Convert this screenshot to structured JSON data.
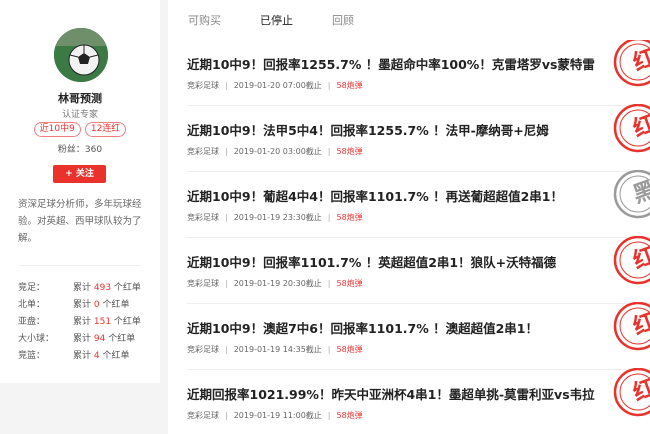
{
  "profile": {
    "name": "林哥预测",
    "cert": "认证专家",
    "badges": [
      "近10中9",
      "12连红"
    ],
    "fans": "粉丝：360",
    "follow_label": "+ 关注",
    "bio": "资深足球分析师，多年玩球经验。对英超、西甲球队较为了解。",
    "stats": [
      {
        "label": "竞足：",
        "prefix": "累计 ",
        "count": "493",
        "suffix": " 个红单"
      },
      {
        "label": "北单：",
        "prefix": "累计 ",
        "count": "0",
        "suffix": " 个红单"
      },
      {
        "label": "亚盘：",
        "prefix": "累计 ",
        "count": "151",
        "suffix": " 个红单"
      },
      {
        "label": "大小球：",
        "prefix": "累计 ",
        "count": "94",
        "suffix": " 个红单"
      },
      {
        "label": "竞篮：",
        "prefix": "累计 ",
        "count": "4",
        "suffix": " 个红单"
      }
    ]
  },
  "tabs": [
    "可购买",
    "已停止",
    "回顾"
  ],
  "active_tab": "已停止",
  "items": [
    {
      "title": "近期10中9！回报率1255.7% ！墨超命中率100%！克雷塔罗vs蒙特雷",
      "category": "竞彩足球",
      "date": "2019-01-20 07:00截止",
      "count": "58炮弹",
      "result": "红",
      "result_color": "#e8322b"
    },
    {
      "title": "近期10中9！法甲5中4！回报率1255.7% ！法甲-摩纳哥+尼姆",
      "category": "竞彩足球",
      "date": "2019-01-20 03:00截止",
      "count": "58炮弹",
      "result": "红",
      "result_color": "#e8322b"
    },
    {
      "title": "近期10中9！葡超4中4！回报率1101.7% ！再送葡超超值2串1！",
      "category": "竞彩足球",
      "date": "2019-01-19 23:30截止",
      "count": "58炮弹",
      "result": "黑",
      "result_color": "#9a9a9a"
    },
    {
      "title": "近期10中9！回报率1101.7% ！英超超值2串1！狼队+沃特福德",
      "category": "竞彩足球",
      "date": "2019-01-19 20:30截止",
      "count": "58炮弹",
      "result": "红",
      "result_color": "#e8322b"
    },
    {
      "title": "近期10中9！澳超7中6！回报率1101.7% ！澳超超值2串1！",
      "category": "竞彩足球",
      "date": "2019-01-19 14:35截止",
      "count": "58炮弹",
      "result": "红",
      "result_color": "#e8322b"
    },
    {
      "title": "近期回报率1021.99%！昨天中亚洲杯4串1！墨超单挑-莫雷利亚vs韦拉",
      "category": "竞彩足球",
      "date": "2019-01-19 11:00截止",
      "count": "58炮弹",
      "result": "红",
      "result_color": "#e8322b"
    }
  ]
}
